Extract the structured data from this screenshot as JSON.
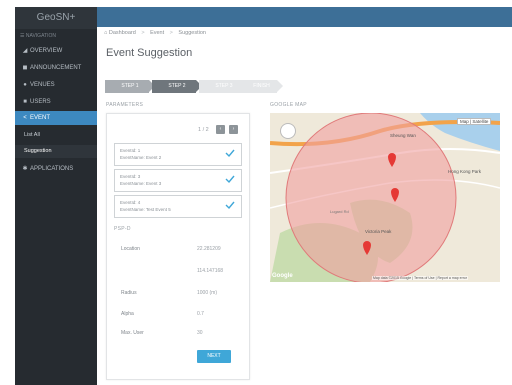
{
  "app": {
    "brand": "GeoSN+"
  },
  "sidebar": {
    "toggle_label": "NAVIGATION",
    "items": [
      {
        "label": "OVERVIEW",
        "icon": "bar-chart-icon"
      },
      {
        "label": "ANNOUNCEMENT",
        "icon": "megaphone-icon"
      },
      {
        "label": "VENUES",
        "icon": "map-marker-icon"
      },
      {
        "label": "USERS",
        "icon": "users-icon"
      },
      {
        "label": "EVENT",
        "icon": "share-icon"
      },
      {
        "label": "APPLICATIONS",
        "icon": "gear-icon"
      }
    ],
    "sub_items": [
      {
        "label": "List All"
      },
      {
        "label": "Suggestion"
      }
    ]
  },
  "breadcrumb": {
    "items": [
      "Dashboard",
      "Event",
      "Suggestion"
    ],
    "home_icon": "home-icon"
  },
  "page": {
    "title": "Event Suggestion"
  },
  "steps": [
    {
      "label": "STEP 1"
    },
    {
      "label": "STEP 2"
    },
    {
      "label": "STEP 3"
    },
    {
      "label": "FINISH"
    }
  ],
  "parameters": {
    "heading": "PARAMETERS",
    "pager_text": "1 / 2",
    "pager_prev": "‹",
    "pager_next": "›",
    "events": [
      {
        "line1": "EventId: 1",
        "line2": "EventName: Event 2"
      },
      {
        "line1": "EventId: 3",
        "line2": "EventName: Event 3"
      },
      {
        "line1": "EventId: 4",
        "line2": "EventName: Test Event 5"
      }
    ],
    "subheading": "PSP-D",
    "fields": [
      {
        "label": "Location",
        "value": "22.281209"
      },
      {
        "label": "",
        "value": "114.147168"
      },
      {
        "label": "Radius",
        "value": "1000 (m)"
      },
      {
        "label": "Alpha",
        "value": "0.7"
      },
      {
        "label": "Max. User",
        "value": "30"
      }
    ],
    "next_label": "NEXT"
  },
  "map": {
    "heading": "GOOGLE MAP",
    "type_label": "Map | Satellite",
    "footer": "Map data ©2015 Google | Terms of Use | Report a map error",
    "logo": "Google",
    "labels": [
      "Sheung Wan",
      "Hong Kong Park",
      "Victoria Peak",
      "Lugard Rd"
    ],
    "colors": {
      "circle_fill": "#f0a0a0",
      "marker": "#e53935",
      "road": "#f2a34a",
      "water": "#a9d0ec"
    }
  }
}
